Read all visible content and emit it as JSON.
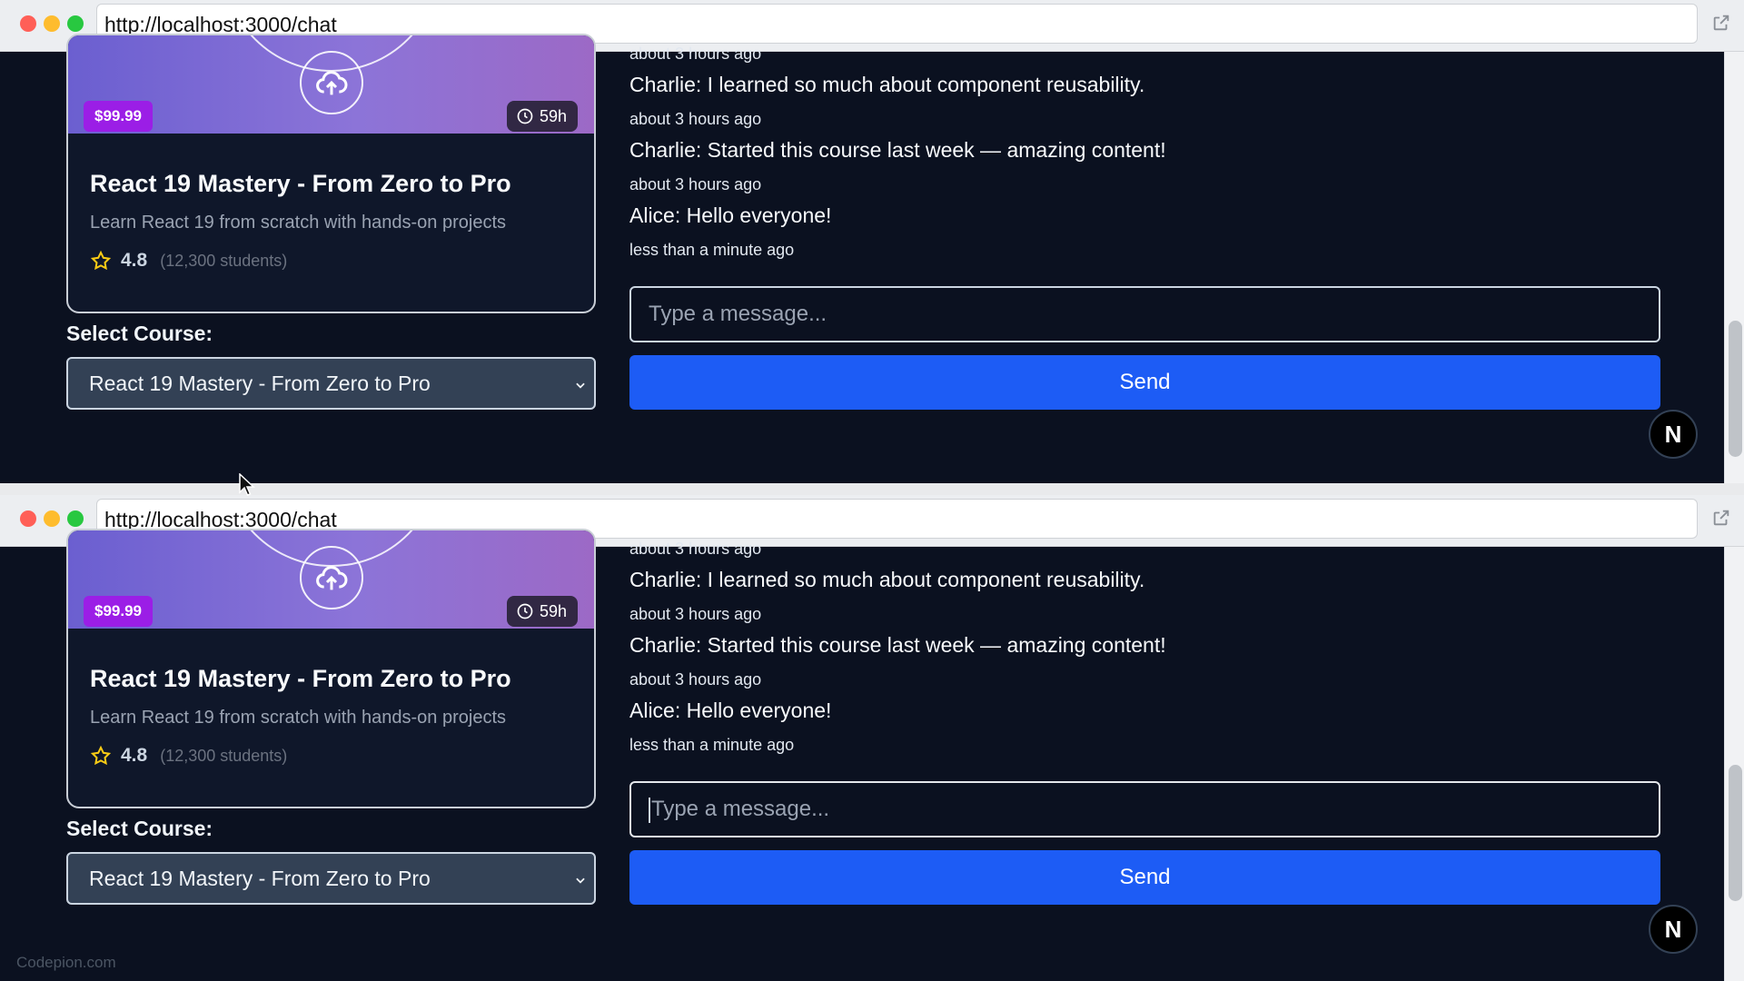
{
  "windows": [
    {
      "url": "http://localhost:3000/chat",
      "course_card": {
        "price": "$99.99",
        "duration": "59h",
        "title": "React 19 Mastery - From Zero to Pro",
        "description": "Learn React 19 from scratch with hands-on projects",
        "rating": "4.8",
        "students": "(12,300 students)"
      },
      "select_label": "Select Course:",
      "selected_course": "React 19 Mastery - From Zero to Pro",
      "messages": [
        {
          "text": "Charlie: I learned so much about component reusability.",
          "time": "about 3 hours ago"
        },
        {
          "text": "Charlie: Started this course last week — amazing content!",
          "time": "about 3 hours ago"
        },
        {
          "text": "Alice: Hello everyone!",
          "time": "less than a minute ago"
        }
      ],
      "top_time": "about 3 hours ago",
      "input_placeholder": "Type a message...",
      "send_label": "Send",
      "badge": "N"
    },
    {
      "url": "http://localhost:3000/chat",
      "course_card": {
        "price": "$99.99",
        "duration": "59h",
        "title": "React 19 Mastery - From Zero to Pro",
        "description": "Learn React 19 from scratch with hands-on projects",
        "rating": "4.8",
        "students": "(12,300 students)"
      },
      "select_label": "Select Course:",
      "selected_course": "React 19 Mastery - From Zero to Pro",
      "messages": [
        {
          "text": "Charlie: I learned so much about component reusability.",
          "time": "about 3 hours ago"
        },
        {
          "text": "Charlie: Started this course last week — amazing content!",
          "time": "about 3 hours ago"
        },
        {
          "text": "Alice: Hello everyone!",
          "time": "less than a minute ago"
        }
      ],
      "top_time": "about 3 hours ago",
      "input_placeholder": "Type a message...",
      "send_label": "Send",
      "badge": "N"
    }
  ],
  "watermark": "Codepion.com",
  "colors": {
    "page_bg": "#0b1120",
    "send_button": "#1d5cf5",
    "price_badge": "#9b1ee6",
    "star": "#facc15"
  },
  "icons": [
    "external-link-icon",
    "cloud-upload-icon",
    "clock-icon",
    "star-icon",
    "chevron-down-icon",
    "mouse-cursor-icon"
  ]
}
